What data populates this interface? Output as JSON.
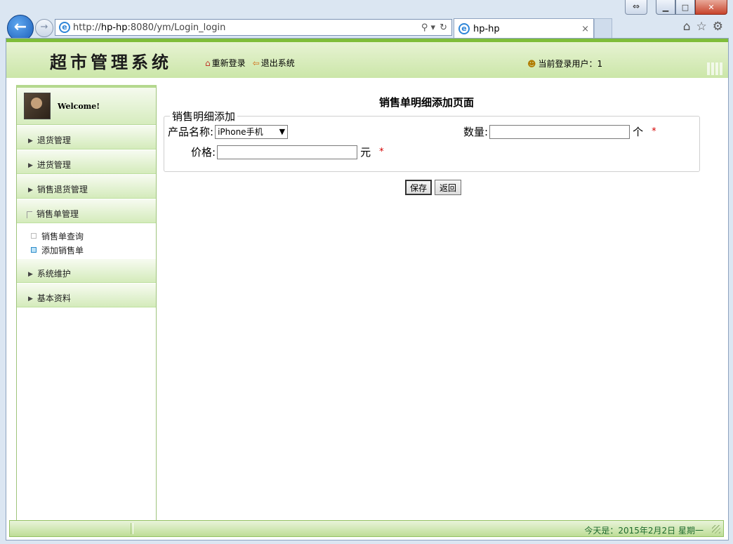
{
  "browser": {
    "address_prefix": "http://",
    "address_host": "hp-hp",
    "address_rest": ":8080/ym/Login_login",
    "tab_title": "hp-hp",
    "tab_close": "×"
  },
  "header": {
    "logo": "超市管理系统",
    "relogin": "重新登录",
    "logout": "退出系统",
    "current_user": "当前登录用户：1"
  },
  "sidebar": {
    "welcome": "Welcome!",
    "items": [
      {
        "label": "退货管理"
      },
      {
        "label": "进货管理"
      },
      {
        "label": "销售退货管理"
      },
      {
        "label": "销售单管理"
      },
      {
        "label": "系统维护"
      },
      {
        "label": "基本资料"
      }
    ],
    "sub_items": [
      {
        "label": "销售单查询"
      },
      {
        "label": "添加销售单"
      }
    ]
  },
  "main": {
    "title": "销售单明细添加页面",
    "legend": "销售明细添加",
    "product_label": "产品名称:",
    "product_selected": "iPhone手机",
    "quantity_label": "数量:",
    "quantity_value": "",
    "quantity_unit": "个",
    "price_label": "价格:",
    "price_value": "",
    "price_unit": "元",
    "required_mark": "*",
    "save_label": "保存",
    "back_label": "返回"
  },
  "footer": {
    "date_text": "今天是：2015年2月2日  星期一"
  }
}
